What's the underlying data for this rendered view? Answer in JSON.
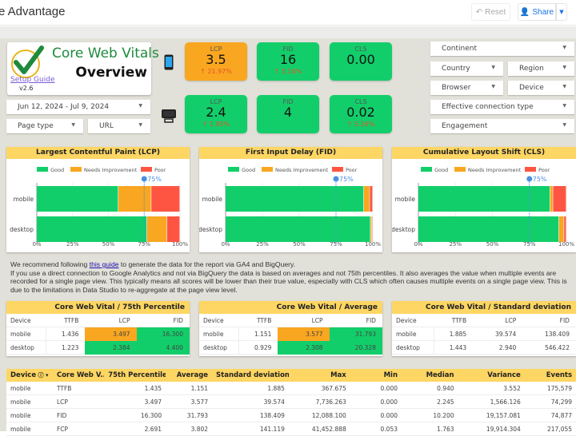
{
  "header": {
    "title": "e Advantage",
    "reset_label": "Reset",
    "share_label": "Share"
  },
  "logo": {
    "title": "Core Web Vitals",
    "subtitle": "Overview",
    "setup_link": "Setup Guide",
    "version": "v2.6"
  },
  "filters": {
    "date_range": "Jun 12, 2024 - Jul 9, 2024",
    "page_type": "Page type",
    "url": "URL",
    "continent": "Continent",
    "country": "Country",
    "region": "Region",
    "browser": "Browser",
    "device": "Device",
    "connection": "Effective connection type",
    "engagement": "Engagement"
  },
  "kpis": {
    "mobile": [
      {
        "label": "LCP",
        "value": "3.5",
        "change": "21.97%",
        "status": "orange"
      },
      {
        "label": "FID",
        "value": "16",
        "change": "5.16%",
        "status": "green"
      },
      {
        "label": "CLS",
        "value": "0.00",
        "change": "",
        "status": "green"
      }
    ],
    "desktop": [
      {
        "label": "LCP",
        "value": "2.4",
        "change": "1.85%",
        "status": "green"
      },
      {
        "label": "FID",
        "value": "4",
        "change": "",
        "status": "green"
      },
      {
        "label": "CLS",
        "value": "0.02",
        "change": "5.26%",
        "status": "green"
      }
    ]
  },
  "chart_data": [
    {
      "type": "bar",
      "title": "Largest Contentful Paint (LCP)",
      "categories": [
        "mobile",
        "desktop"
      ],
      "series": [
        {
          "name": "Good",
          "values": [
            57,
            77
          ]
        },
        {
          "name": "Needs Improvement",
          "values": [
            23,
            14
          ]
        },
        {
          "name": "Poor",
          "values": [
            20,
            9
          ]
        }
      ],
      "xticks": [
        "0%",
        "25%",
        "50%",
        "75%",
        "100%"
      ],
      "reference_line": {
        "label": "75%",
        "value": 75
      },
      "xlim": [
        0,
        100
      ],
      "stacked": true,
      "orientation": "horizontal",
      "legend": "top"
    },
    {
      "type": "bar",
      "title": "First Input Delay (FID)",
      "categories": [
        "mobile",
        "desktop"
      ],
      "series": [
        {
          "name": "Good",
          "values": [
            94,
            98.5
          ]
        },
        {
          "name": "Needs Improvement",
          "values": [
            4,
            1
          ]
        },
        {
          "name": "Poor",
          "values": [
            2,
            0.5
          ]
        }
      ],
      "xticks": [
        "0%",
        "25%",
        "50%",
        "75%",
        "100%"
      ],
      "reference_line": {
        "label": "75%",
        "value": 75
      },
      "xlim": [
        0,
        100
      ],
      "stacked": true,
      "orientation": "horizontal",
      "legend": "top"
    },
    {
      "type": "bar",
      "title": "Cumulative Layout Shift (CLS)",
      "categories": [
        "mobile",
        "desktop"
      ],
      "series": [
        {
          "name": "Good",
          "values": [
            89,
            95
          ]
        },
        {
          "name": "Needs Improvement",
          "values": [
            2,
            3.5
          ]
        },
        {
          "name": "Poor",
          "values": [
            9,
            1.5
          ]
        }
      ],
      "xticks": [
        "0%",
        "25%",
        "50%",
        "75%",
        "100%"
      ],
      "reference_line": {
        "label": "75%",
        "value": 75
      },
      "xlim": [
        0,
        100
      ],
      "stacked": true,
      "orientation": "horizontal",
      "legend": "top"
    }
  ],
  "colors": {
    "good": "#12ce6a",
    "needs_improvement": "#f9a620",
    "poor": "#fe5543",
    "reference": "#4a90e2",
    "header_yellow": "#fdd663"
  },
  "note": {
    "line1_prefix": "We recommend following ",
    "line1_link": "this guide",
    "line1_suffix": " to generate the data for the report via GA4 and BigQuery.",
    "line2": "If you use a direct connection to Google Analytics and not via BigQuery the data is based on averages and not 75th percentiles. It also averages the value when multiple events are recorded for a single page view. This typically means all scores will be lower than their true value, especially with CLS which often causes multiple events on a single page view. This is due to the limitations in Data Studio to re-aggregate at the page view level."
  },
  "summary_tables": [
    {
      "title": "Core Web Vital / 75th Percentile",
      "columns": [
        "Device",
        "TTFB",
        "LCP",
        "FID"
      ],
      "rows": [
        {
          "cells": [
            "mobile",
            "1.436",
            "3.497",
            "16.300"
          ],
          "status": [
            "",
            "",
            "orange",
            "green"
          ]
        },
        {
          "cells": [
            "desktop",
            "1.223",
            "2.384",
            "4.400"
          ],
          "status": [
            "",
            "",
            "green",
            "green"
          ]
        }
      ]
    },
    {
      "title": "Core Web Vital / Average",
      "columns": [
        "Device",
        "TTFB",
        "LCP",
        "FID"
      ],
      "rows": [
        {
          "cells": [
            "mobile",
            "1.151",
            "3.577",
            "31.793"
          ],
          "status": [
            "",
            "",
            "orange",
            "green"
          ]
        },
        {
          "cells": [
            "desktop",
            "0.929",
            "2.308",
            "20.328"
          ],
          "status": [
            "",
            "",
            "green",
            "green"
          ]
        }
      ]
    },
    {
      "title": "Core Web Vital / Standard deviation",
      "columns": [
        "Device",
        "TTFB",
        "LCP",
        "FID"
      ],
      "rows": [
        {
          "cells": [
            "mobile",
            "1.885",
            "39.574",
            "138.409"
          ],
          "status": [
            "",
            "",
            "",
            ""
          ]
        },
        {
          "cells": [
            "desktop",
            "1.443",
            "2.940",
            "546.422"
          ],
          "status": [
            "",
            "",
            "",
            ""
          ]
        }
      ]
    }
  ],
  "detail_table": {
    "columns": [
      "Device",
      "Core Web V...",
      "75th Percentile",
      "Average",
      "Standard deviation",
      "Max",
      "Min",
      "Median",
      "Variance",
      "Events"
    ],
    "rows": [
      [
        "mobile",
        "TTFB",
        "1.435",
        "1.151",
        "1.885",
        "367.675",
        "0.000",
        "0.940",
        "3.552",
        "175,579"
      ],
      [
        "mobile",
        "LCP",
        "3.497",
        "3.577",
        "39.574",
        "7,736.263",
        "0.000",
        "2.245",
        "1,566.126",
        "74,299"
      ],
      [
        "mobile",
        "FID",
        "16.300",
        "31.793",
        "138.409",
        "12,088.100",
        "0.000",
        "10.200",
        "19,157.081",
        "74,877"
      ],
      [
        "mobile",
        "FCP",
        "2.691",
        "3.802",
        "141.119",
        "41,452.888",
        "0.053",
        "1.763",
        "19,914.304",
        "217,055"
      ]
    ]
  }
}
